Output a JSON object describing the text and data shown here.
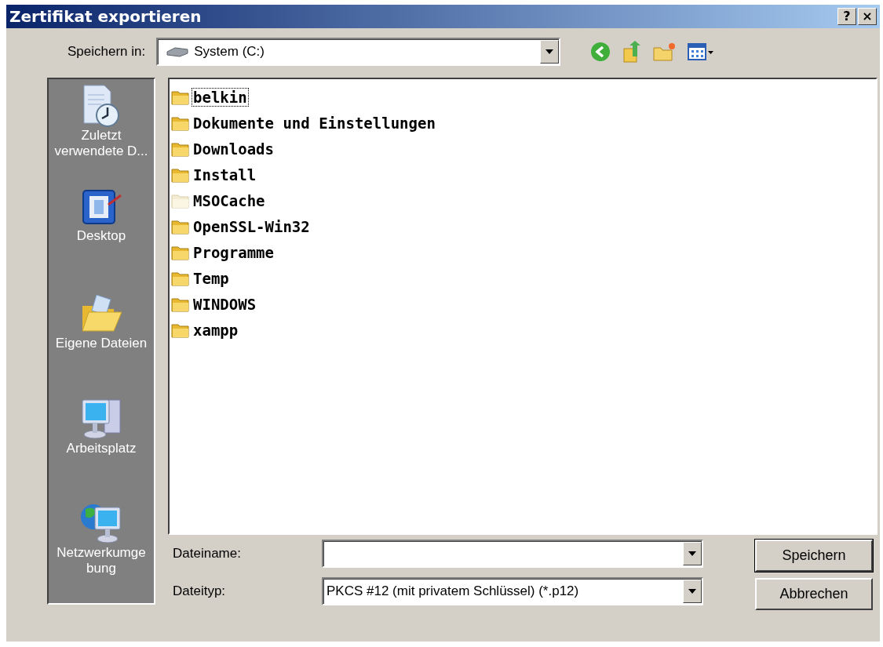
{
  "window": {
    "title": "Zertifikat exportieren",
    "buttons": [
      "?",
      "×"
    ]
  },
  "save_in": {
    "label": "Speichern in:",
    "value": "System (C:)"
  },
  "places": [
    {
      "kind": "recent",
      "label": "Zuletzt verwendete D..."
    },
    {
      "kind": "desktop",
      "label": "Desktop"
    },
    {
      "kind": "documents",
      "label": "Eigene Dateien"
    },
    {
      "kind": "computer",
      "label": "Arbeitsplatz"
    },
    {
      "kind": "network",
      "label": "Netzwerkumge bung"
    }
  ],
  "files": [
    {
      "name": "belkin",
      "focused": true,
      "hidden": false
    },
    {
      "name": "Dokumente und Einstellungen",
      "focused": false,
      "hidden": false
    },
    {
      "name": "Downloads",
      "focused": false,
      "hidden": false
    },
    {
      "name": "Install",
      "focused": false,
      "hidden": false
    },
    {
      "name": "MSOCache",
      "focused": false,
      "hidden": true
    },
    {
      "name": "OpenSSL-Win32",
      "focused": false,
      "hidden": false
    },
    {
      "name": "Programme",
      "focused": false,
      "hidden": false
    },
    {
      "name": "Temp",
      "focused": false,
      "hidden": false
    },
    {
      "name": "WINDOWS",
      "focused": false,
      "hidden": false
    },
    {
      "name": "xampp",
      "focused": false,
      "hidden": false
    }
  ],
  "file_name": {
    "label": "Dateiname:"
  },
  "file_type": {
    "label": "Dateityp:",
    "value": "PKCS #12 (mit privatem Schlüssel) (*.p12)"
  },
  "buttons": [
    {
      "label": "Speichern",
      "default": true
    },
    {
      "label": "Abbrechen",
      "default": false
    }
  ]
}
